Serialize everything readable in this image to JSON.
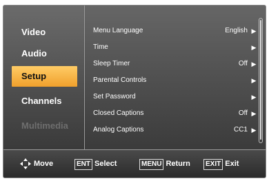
{
  "sidebar": {
    "items": [
      {
        "label": "Video",
        "state": "normal"
      },
      {
        "label": "Audio",
        "state": "normal"
      },
      {
        "label": "Setup",
        "state": "selected"
      },
      {
        "label": "Channels",
        "state": "normal"
      },
      {
        "label": "Multimedia",
        "state": "disabled"
      }
    ]
  },
  "menu": {
    "rows": [
      {
        "label": "Menu Language",
        "value": "English"
      },
      {
        "label": "Time",
        "value": ""
      },
      {
        "label": "Sleep Timer",
        "value": "Off"
      },
      {
        "label": "Parental Controls",
        "value": ""
      },
      {
        "label": "Set Password",
        "value": ""
      },
      {
        "label": "Closed Captions",
        "value": "Off"
      },
      {
        "label": "Analog Captions",
        "value": "CC1"
      }
    ],
    "arrow_glyph": "▶"
  },
  "hints": {
    "move": "Move",
    "select_key": "ENT",
    "select": "Select",
    "return_key": "MENU",
    "return": "Return",
    "exit_key": "EXIT",
    "exit": "Exit"
  },
  "colors": {
    "selected_bg": "#f5b44a",
    "frame_bg": "#3f3f3f"
  }
}
